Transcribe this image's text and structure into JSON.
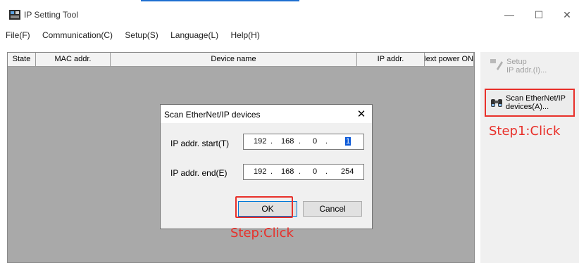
{
  "window": {
    "title": "IP Setting Tool",
    "controls": {
      "minimize": "—",
      "maximize": "☐",
      "close": "✕"
    }
  },
  "menu": [
    "File(F)",
    "Communication(C)",
    "Setup(S)",
    "Language(L)",
    "Help(H)"
  ],
  "table": {
    "columns": [
      "State",
      "MAC addr.",
      "Device name",
      "IP addr.",
      "Next power ON"
    ]
  },
  "side_buttons": {
    "setup": {
      "line1": "Setup",
      "line2": "IP addr.(I)...",
      "enabled": false
    },
    "scan": {
      "line1": "Scan EtherNet/IP",
      "line2": "devices(A)..."
    }
  },
  "annotations": {
    "step1": "Step1:Click",
    "step2": "Step:Click",
    "color": "#e8302a"
  },
  "dialog": {
    "title": "Scan EtherNet/IP devices",
    "close": "✕",
    "start_label": "IP addr. start(T)",
    "end_label": "IP addr. end(E)",
    "start_ip": [
      "192",
      "168",
      "0",
      "1"
    ],
    "end_ip": [
      "192",
      "168",
      "0",
      "254"
    ],
    "ok": "OK",
    "cancel": "Cancel"
  }
}
